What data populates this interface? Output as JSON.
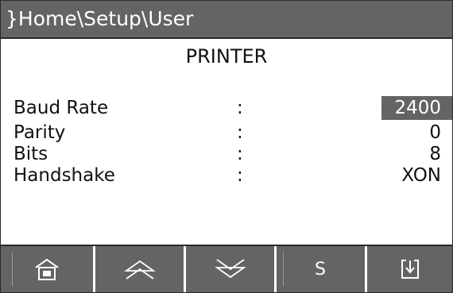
{
  "title": "}Home\\Setup\\User",
  "heading": "PRINTER",
  "separator": ":",
  "rows": [
    {
      "label": "Baud Rate",
      "value": "2400",
      "selected": true
    },
    {
      "label": "Parity",
      "value": "0",
      "selected": false
    },
    {
      "label": "Bits",
      "value": "8",
      "selected": false
    },
    {
      "label": "Handshake",
      "value": "XON",
      "selected": false
    }
  ],
  "softkeys": [
    {
      "icon": "home-icon"
    },
    {
      "icon": "page-up-icon"
    },
    {
      "icon": "page-down-icon"
    },
    {
      "icon": "s-key",
      "label": "S"
    },
    {
      "icon": "exit-icon"
    }
  ],
  "colors": {
    "bar": "#646464",
    "text": "#111111",
    "highlight_text": "#ffffff"
  }
}
